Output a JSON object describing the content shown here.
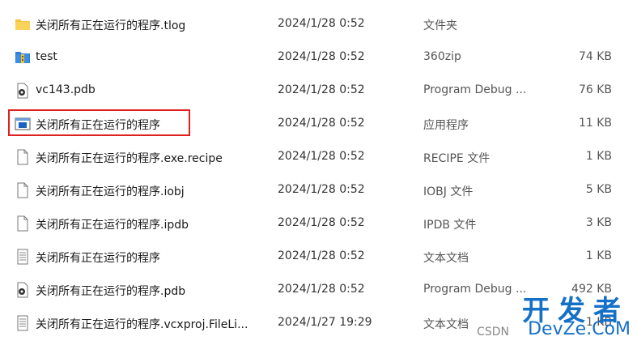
{
  "rows": [
    {
      "name": "关闭所有正在运行的程序.tlog",
      "date": "2024/1/28 0:52",
      "type": "文件夹",
      "size": "",
      "icon": "folder-icon"
    },
    {
      "name": "test",
      "date": "2024/1/28 0:52",
      "type": "360zip",
      "size": "74 KB",
      "icon": "archive-icon"
    },
    {
      "name": "vc143.pdb",
      "date": "2024/1/28 0:52",
      "type": "Program Debug ...",
      "size": "76 KB",
      "icon": "pdb-file-icon"
    },
    {
      "name": "关闭所有正在运行的程序",
      "date": "2024/1/28 0:52",
      "type": "应用程序",
      "size": "11 KB",
      "icon": "application-icon"
    },
    {
      "name": "关闭所有正在运行的程序.exe.recipe",
      "date": "2024/1/28 0:52",
      "type": "RECIPE 文件",
      "size": "1 KB",
      "icon": "blank-file-icon"
    },
    {
      "name": "关闭所有正在运行的程序.iobj",
      "date": "2024/1/28 0:52",
      "type": "IOBJ 文件",
      "size": "5 KB",
      "icon": "blank-file-icon"
    },
    {
      "name": "关闭所有正在运行的程序.ipdb",
      "date": "2024/1/28 0:52",
      "type": "IPDB 文件",
      "size": "3 KB",
      "icon": "blank-file-icon"
    },
    {
      "name": "关闭所有正在运行的程序",
      "date": "2024/1/28 0:52",
      "type": "文本文档",
      "size": "1 KB",
      "icon": "text-file-icon"
    },
    {
      "name": "关闭所有正在运行的程序.pdb",
      "date": "2024/1/28 0:52",
      "type": "Program Debug ...",
      "size": "492 KB",
      "icon": "pdb-file-icon"
    },
    {
      "name": "关闭所有正在运行的程序.vcxproj.FileLi...",
      "date": "2024/1/27 19:29",
      "type": "文本文档",
      "size": "1 KB",
      "icon": "text-file-icon"
    }
  ],
  "highlighted_row_index": 3,
  "watermark": {
    "big": "开发者",
    "small": "DevZe.CoM",
    "csdn": "CSDN"
  },
  "colors": {
    "highlight": "#e02020",
    "folder": "#f5c342",
    "watermark": "#1570c8"
  }
}
